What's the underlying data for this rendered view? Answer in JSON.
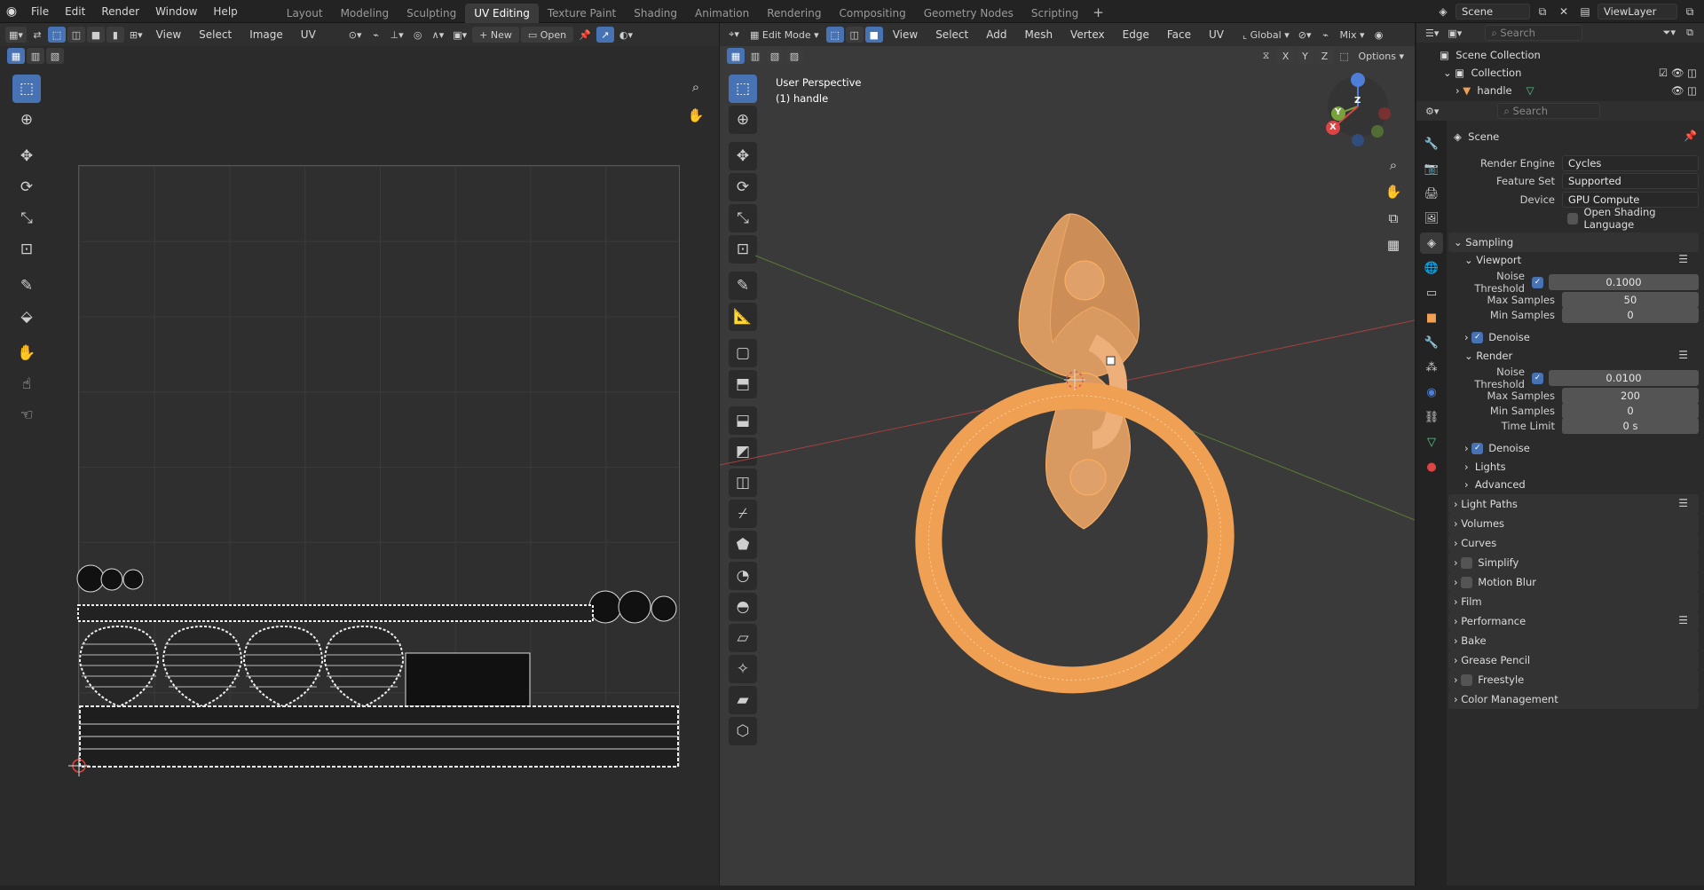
{
  "topbar": {
    "menus": [
      "File",
      "Edit",
      "Render",
      "Window",
      "Help"
    ],
    "workspaces": [
      "Layout",
      "Modeling",
      "Sculpting",
      "UV Editing",
      "Texture Paint",
      "Shading",
      "Animation",
      "Rendering",
      "Compositing",
      "Geometry Nodes",
      "Scripting"
    ],
    "active_workspace": "UV Editing",
    "scene": "Scene",
    "view_layer": "ViewLayer"
  },
  "uv_editor": {
    "menus": [
      "View",
      "Select",
      "Image",
      "UV"
    ],
    "new_label": "New",
    "open_label": "Open"
  },
  "viewport": {
    "mode": "Edit Mode",
    "menus": [
      "View",
      "Select",
      "Add",
      "Mesh",
      "Vertex",
      "Edge",
      "Face",
      "UV"
    ],
    "orientation": "Global",
    "shading": "Mix",
    "options_label": "Options",
    "axis_buttons": [
      "X",
      "Y",
      "Z"
    ],
    "overlay_line1": "User Perspective",
    "overlay_line2": "(1) handle",
    "gizmo_labels": [
      "Z",
      "Y",
      "X"
    ],
    "mesh_color": "#f0a052"
  },
  "outliner": {
    "search_placeholder": "Search",
    "items": [
      {
        "label": "Scene Collection"
      },
      {
        "label": "Collection"
      },
      {
        "label": "handle"
      }
    ]
  },
  "properties": {
    "search_placeholder": "Search",
    "context": "Scene",
    "render_engine_label": "Render Engine",
    "render_engine": "Cycles",
    "feature_set_label": "Feature Set",
    "feature_set": "Supported",
    "device_label": "Device",
    "device": "GPU Compute",
    "osl_label": "Open Shading Language",
    "sampling": "Sampling",
    "viewport_label": "Viewport",
    "noise_threshold_label": "Noise Threshold",
    "max_samples_label": "Max Samples",
    "min_samples_label": "Min Samples",
    "time_limit_label": "Time Limit",
    "vp_noise": "0.1000",
    "vp_max": "50",
    "vp_min": "0",
    "denoise_label": "Denoise",
    "render_label": "Render",
    "r_noise": "0.0100",
    "r_max": "200",
    "r_min": "0",
    "r_time": "0 s",
    "lights_label": "Lights",
    "advanced_label": "Advanced",
    "panels": [
      "Light Paths",
      "Volumes",
      "Curves",
      "Simplify",
      "Motion Blur",
      "Film",
      "Performance",
      "Bake",
      "Grease Pencil",
      "Freestyle",
      "Color Management"
    ]
  },
  "colors": {
    "accent": "#4772b3",
    "selection": "#f0a052"
  }
}
